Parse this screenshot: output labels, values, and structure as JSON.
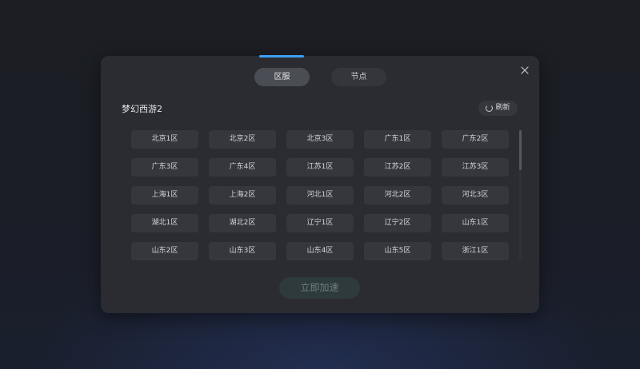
{
  "modal": {
    "tabs": [
      {
        "label": "区服",
        "active": true
      },
      {
        "label": "节点",
        "active": false
      }
    ],
    "close_icon": "close-icon",
    "game_title": "梦幻西游2",
    "refresh": {
      "label": "刷新",
      "icon": "refresh-icon"
    },
    "servers": [
      "北京1区",
      "北京2区",
      "北京3区",
      "广东1区",
      "广东2区",
      "广东3区",
      "广东4区",
      "江苏1区",
      "江苏2区",
      "江苏3区",
      "上海1区",
      "上海2区",
      "河北1区",
      "河北2区",
      "河北3区",
      "湖北1区",
      "湖北2区",
      "辽宁1区",
      "辽宁2区",
      "山东1区",
      "山东2区",
      "山东3区",
      "山东4区",
      "山东5区",
      "浙江1区"
    ],
    "accelerate_label": "立即加速"
  },
  "colors": {
    "accent": "#3d9ff5",
    "modal_background": "#2a2c32",
    "accelerate_disabled": "#2e3a3c"
  }
}
